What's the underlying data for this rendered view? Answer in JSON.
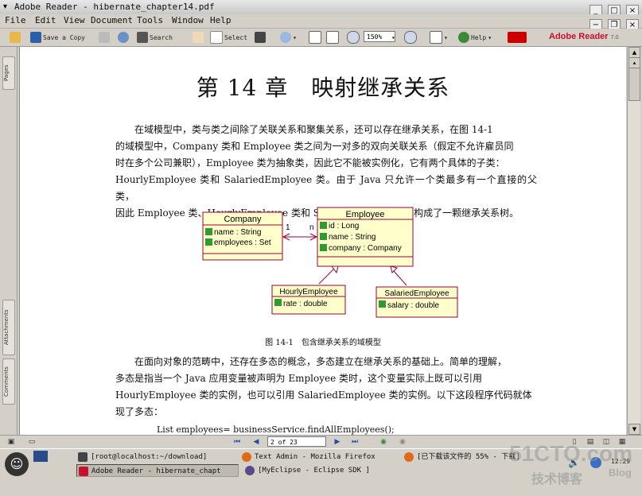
{
  "window": {
    "title": "Adobe Reader - hibernate_chapter14.pdf"
  },
  "menu": [
    "File",
    "Edit",
    "View",
    "Document",
    "Tools",
    "Window",
    "Help"
  ],
  "toolbar": {
    "save_copy": "Save a Copy",
    "search": "Search",
    "select": "Select",
    "zoom": "150%",
    "help": "Help",
    "brand": "Adobe Reader",
    "brand_version": "7.0"
  },
  "side_tabs": [
    "Pages",
    "Attachments",
    "Comments"
  ],
  "document": {
    "chapter_title": "第 14 章　映射继承关系",
    "paragraph1": [
      "在域模型中，类与类之间除了关联关系和聚集关系，还可以存在继承关系，在图 14-1",
      "的域模型中，Company 类和 Employee 类之间为一对多的双向关联关系（假定不允许雇员同",
      "时在多个公司兼职），Employee 类为抽象类，因此它不能被实例化，它有两个具体的子类：",
      "HourlyEmployee 类和 SalariedEmployee 类。由于 Java 只允许一个类最多有一个直接的父类，",
      "因此 Employee 类、HourlyEmployee 类和 SalariedEmployee 类构成了一颗继承关系树。"
    ],
    "uml": {
      "company": {
        "name": "Company",
        "attrs": [
          "name : String",
          "employees : Set"
        ]
      },
      "employee": {
        "name": "Employee",
        "attrs": [
          "id : Long",
          "name : String",
          "company : Company"
        ]
      },
      "hourly": {
        "name": "HourlyEmployee",
        "attrs": [
          "rate : double"
        ]
      },
      "salaried": {
        "name": "SalariedEmployee",
        "attrs": [
          "salary : double"
        ]
      },
      "mult_one": "1",
      "mult_many": "n"
    },
    "figure_caption": "图 14-1　包含继承关系的域模型",
    "paragraph2": [
      "在面向对象的范畴中，还存在多态的概念，多态建立在继承关系的基础上。简单的理解，",
      "多态是指当一个 Java 应用变量被声明为 Employee 类时，这个变量实际上既可以引用",
      "HourlyEmployee 类的实例，也可以引用 SalariedEmployee 类的实例。以下这段程序代码就体",
      "现了多态："
    ],
    "code_line": "List employees= businessService.findAllEmployees();"
  },
  "status": {
    "page_text": "2 of 23"
  },
  "taskbar": {
    "tasks": [
      "[root@localhost:~/download]",
      "Text Admin - Mozilla Firefox",
      "[已下载该文件的 55% - 下载]",
      "Adobe Reader - hibernate_chapt",
      "[MyEclipse - Eclipse SDK ]"
    ],
    "time": "12:29"
  },
  "watermark": {
    "site": "51CTO.com",
    "blog_cn": "技术博客",
    "blog": "Blog"
  },
  "colors": {
    "uml_fill": "#ffffcc",
    "uml_border": "#990033",
    "adobe_red": "#c8102e"
  }
}
